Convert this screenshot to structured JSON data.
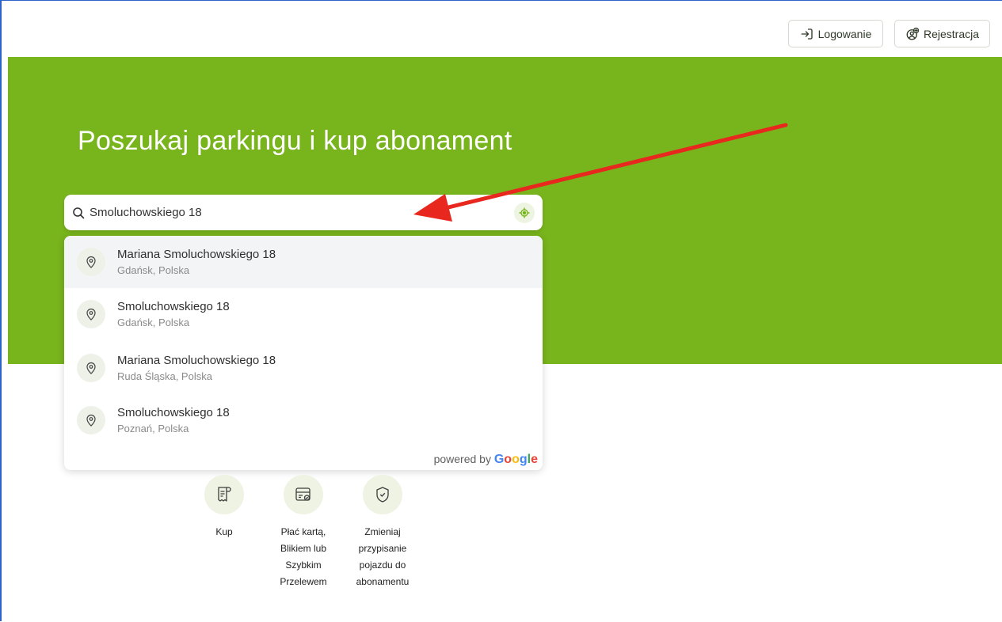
{
  "header": {
    "login_label": "Logowanie",
    "register_label": "Rejestracja"
  },
  "hero": {
    "title": "Poszukaj parkingu i kup abonament"
  },
  "search": {
    "value": "Smoluchowskiego 18"
  },
  "suggestions": [
    {
      "main": "Mariana Smoluchowskiego 18",
      "sub": "Gdańsk, Polska"
    },
    {
      "main": "Smoluchowskiego 18",
      "sub": "Gdańsk, Polska"
    },
    {
      "main": "Mariana Smoluchowskiego 18",
      "sub": "Ruda Śląska, Polska"
    },
    {
      "main": "Smoluchowskiego 18",
      "sub": "Poznań, Polska"
    }
  ],
  "powered_by": {
    "prefix": "powered by",
    "brand": [
      "G",
      "o",
      "o",
      "g",
      "l",
      "e"
    ]
  },
  "features": [
    {
      "label": "Kup",
      "icon": "receipt-icon"
    },
    {
      "label": "Płać kartą, Blikiem lub Szybkim Przelewem",
      "icon": "card-icon"
    },
    {
      "label": "Zmieniaj przypisanie pojazdu do abonamentu",
      "icon": "shield-icon"
    }
  ],
  "colors": {
    "hero_green": "#78b41c",
    "annotation_arrow": "#e8281e"
  }
}
